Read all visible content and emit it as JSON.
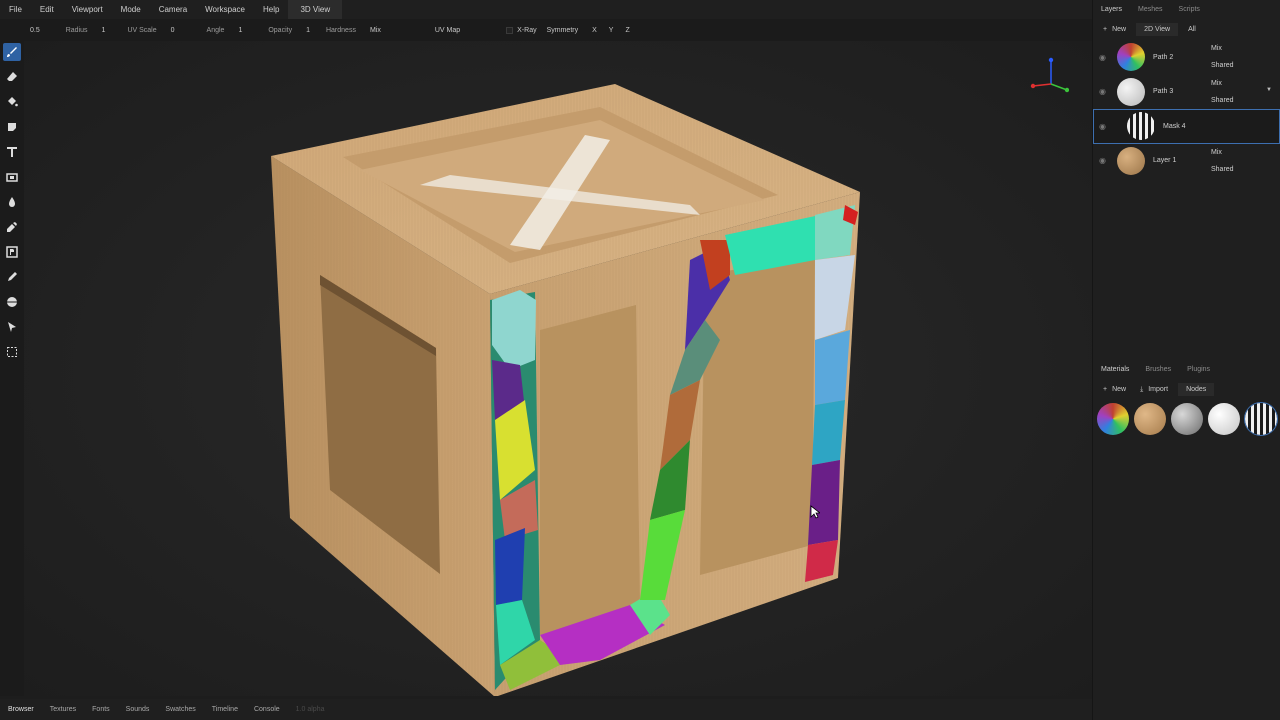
{
  "menu": {
    "file": "File",
    "edit": "Edit",
    "viewport": "Viewport",
    "mode": "Mode",
    "camera": "Camera",
    "workspace": "Workspace",
    "help": "Help",
    "view3d": "3D View"
  },
  "toolbar": {
    "size": "0.5",
    "radius_label": "Radius",
    "radius_val": "1",
    "uvscale_label": "UV Scale",
    "uvscale_val": "0",
    "angle_label": "Angle",
    "angle_val": "1",
    "opacity_label": "Opacity",
    "opacity_val": "1",
    "hardness_label": "Hardness",
    "blend": "Mix",
    "uvmap": "UV Map",
    "xray": "X-Ray",
    "symmetry": "Symmetry",
    "x": "X",
    "y": "Y",
    "z": "Z"
  },
  "tools": [
    "brush-icon",
    "eraser-icon",
    "fill-icon",
    "decal-icon",
    "text-icon",
    "clone-icon",
    "blur-icon",
    "smudge-icon",
    "bake-icon",
    "picker-icon",
    "sphere-icon",
    "cursor-icon",
    "select-rect-icon"
  ],
  "rpanel": {
    "tabs": {
      "layers": "Layers",
      "meshes": "Meshes",
      "scripts": "Scripts"
    },
    "bar": {
      "new": "New",
      "view2d": "2D View",
      "all": "All"
    },
    "layers": [
      {
        "name": "Path 2",
        "blend": "Mix",
        "mode": "Shared"
      },
      {
        "name": "Path 3",
        "blend": "Mix",
        "mode": "Shared"
      },
      {
        "name": "Mask 4",
        "blend": "",
        "mode": ""
      },
      {
        "name": "Layer 1",
        "blend": "Mix",
        "mode": "Shared"
      }
    ],
    "mat_tabs": {
      "materials": "Materials",
      "brushes": "Brushes",
      "plugins": "Plugins"
    },
    "mat_bar": {
      "new": "New",
      "import": "Import",
      "nodes": "Nodes"
    }
  },
  "bottom": {
    "browser": "Browser",
    "textures": "Textures",
    "fonts": "Fonts",
    "sounds": "Sounds",
    "swatches": "Swatches",
    "timeline": "Timeline",
    "console": "Console",
    "version": "1.0 alpha"
  },
  "colors": {
    "accent": "#2f62a3",
    "wood": "#c29a6a"
  }
}
